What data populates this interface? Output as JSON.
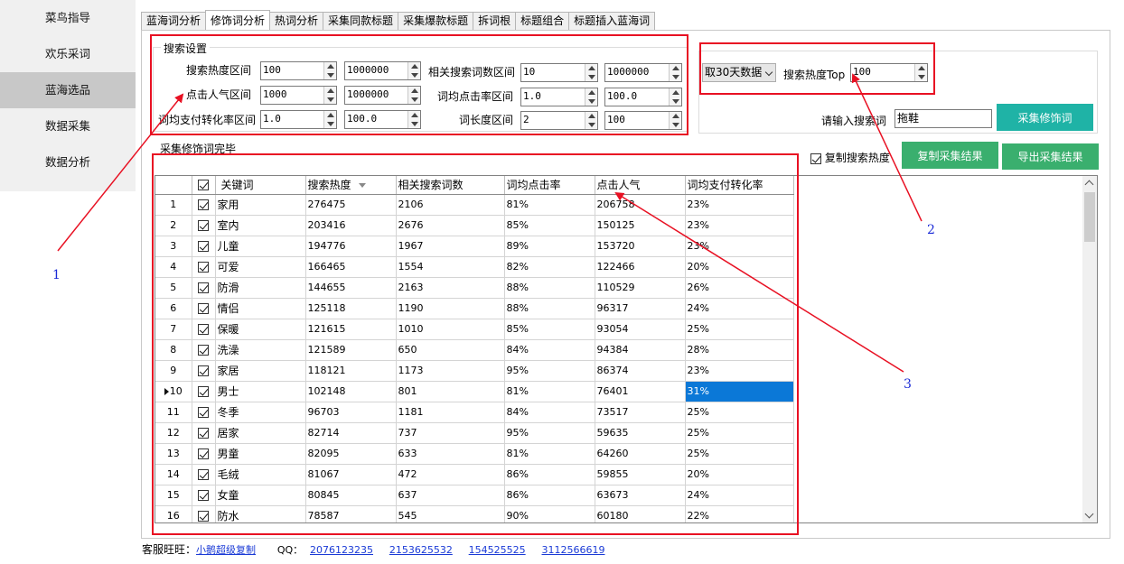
{
  "sidebar": {
    "items": [
      {
        "label": "菜鸟指导"
      },
      {
        "label": "欢乐采词"
      },
      {
        "label": "蓝海选品",
        "active": true
      },
      {
        "label": "数据采集"
      },
      {
        "label": "数据分析"
      }
    ]
  },
  "tabs": [
    {
      "label": "蓝海词分析"
    },
    {
      "label": "修饰词分析",
      "active": true
    },
    {
      "label": "热词分析"
    },
    {
      "label": "采集同款标题"
    },
    {
      "label": "采集爆款标题"
    },
    {
      "label": "拆词根"
    },
    {
      "label": "标题组合"
    },
    {
      "label": "标题插入蓝海词"
    }
  ],
  "search_settings": {
    "title": "搜索设置",
    "search_heat_label": "搜索热度区间",
    "search_heat_min": "100",
    "search_heat_max": "1000000",
    "related_count_label": "相关搜索词数区间",
    "related_count_min": "10",
    "related_count_max": "1000000",
    "click_pop_label": "点击人气区间",
    "click_pop_min": "1000",
    "click_pop_max": "1000000",
    "avg_ctr_label": "词均点击率区间",
    "avg_ctr_min": "1.0",
    "avg_ctr_max": "100.0",
    "avg_cvr_label": "词均支付转化率区间",
    "avg_cvr_min": "1.0",
    "avg_cvr_max": "100.0",
    "word_len_label": "词长度区间",
    "word_len_min": "2",
    "word_len_max": "100"
  },
  "right_panel": {
    "period_select": "取30天数据",
    "top_label": "搜索热度Top",
    "top_value": "100",
    "keyword_label": "请输入搜索词",
    "keyword_value": "拖鞋",
    "collect_button": "采集修饰词",
    "copy_heat_label": "复制搜索热度",
    "copy_results_button": "复制采集结果",
    "export_results_button": "导出采集结果"
  },
  "status": "采集修饰词完毕",
  "table": {
    "headers": [
      "关键词",
      "搜索热度",
      "相关搜索词数",
      "词均点击率",
      "点击人气",
      "词均支付转化率"
    ],
    "selected_row": 10,
    "rows": [
      {
        "n": "1",
        "kw": "家用",
        "heat": "276475",
        "rel": "2106",
        "ctr": "81%",
        "pop": "206758",
        "cvr": "23%"
      },
      {
        "n": "2",
        "kw": "室内",
        "heat": "203416",
        "rel": "2676",
        "ctr": "85%",
        "pop": "150125",
        "cvr": "23%"
      },
      {
        "n": "3",
        "kw": "儿童",
        "heat": "194776",
        "rel": "1967",
        "ctr": "89%",
        "pop": "153720",
        "cvr": "23%"
      },
      {
        "n": "4",
        "kw": "可爱",
        "heat": "166465",
        "rel": "1554",
        "ctr": "82%",
        "pop": "122466",
        "cvr": "20%"
      },
      {
        "n": "5",
        "kw": "防滑",
        "heat": "144655",
        "rel": "2163",
        "ctr": "88%",
        "pop": "110529",
        "cvr": "26%"
      },
      {
        "n": "6",
        "kw": "情侣",
        "heat": "125118",
        "rel": "1190",
        "ctr": "88%",
        "pop": "96317",
        "cvr": "24%"
      },
      {
        "n": "7",
        "kw": "保暖",
        "heat": "121615",
        "rel": "1010",
        "ctr": "85%",
        "pop": "93054",
        "cvr": "25%"
      },
      {
        "n": "8",
        "kw": "洗澡",
        "heat": "121589",
        "rel": "650",
        "ctr": "84%",
        "pop": "94384",
        "cvr": "28%"
      },
      {
        "n": "9",
        "kw": "家居",
        "heat": "118121",
        "rel": "1173",
        "ctr": "95%",
        "pop": "86374",
        "cvr": "23%"
      },
      {
        "n": "10",
        "kw": "男士",
        "heat": "102148",
        "rel": "801",
        "ctr": "81%",
        "pop": "76401",
        "cvr": "31%"
      },
      {
        "n": "11",
        "kw": "冬季",
        "heat": "96703",
        "rel": "1181",
        "ctr": "84%",
        "pop": "73517",
        "cvr": "25%"
      },
      {
        "n": "12",
        "kw": "居家",
        "heat": "82714",
        "rel": "737",
        "ctr": "95%",
        "pop": "59635",
        "cvr": "25%"
      },
      {
        "n": "13",
        "kw": "男童",
        "heat": "82095",
        "rel": "633",
        "ctr": "81%",
        "pop": "64260",
        "cvr": "25%"
      },
      {
        "n": "14",
        "kw": "毛绒",
        "heat": "81067",
        "rel": "472",
        "ctr": "86%",
        "pop": "59855",
        "cvr": "20%"
      },
      {
        "n": "15",
        "kw": "女童",
        "heat": "80845",
        "rel": "637",
        "ctr": "86%",
        "pop": "63673",
        "cvr": "24%"
      },
      {
        "n": "16",
        "kw": "防水",
        "heat": "78587",
        "rel": "545",
        "ctr": "90%",
        "pop": "60180",
        "cvr": "22%"
      }
    ]
  },
  "footer": {
    "service_label": "客服旺旺：",
    "service_link": "小鹅超级复制",
    "qq_label": "QQ：",
    "qq_numbers": [
      "2076123235",
      "2153625532",
      "154525525",
      "3112566619"
    ]
  },
  "annotations": [
    "1",
    "2",
    "3"
  ],
  "colors": {
    "annotation_red": "#e81123",
    "annotation_blue": "#1a2ad6",
    "teal_button": "#1fb3a6",
    "green_button": "#3aaf6e",
    "selection": "#0b78d7"
  }
}
